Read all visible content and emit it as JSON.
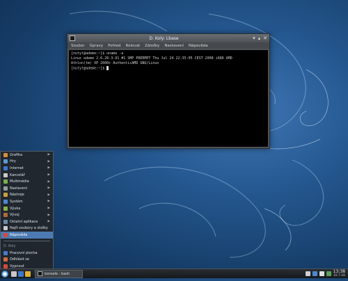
{
  "window": {
    "title": "D. Koly: Lbase",
    "menu": [
      "Soubor",
      "Úpravy",
      "Pohled",
      "Rolovat",
      "Záložky",
      "Nastavení",
      "Nápověda"
    ],
    "terminal_lines": [
      "[nutyt@ademe:~]$ uname -a",
      "Linux ademe 2.6.28-3-91 #1 SMP PREEMPT Thu Jul 24 22:35:05 CEST 2008 i686 AMD",
      "Athlon(tm) XP 2600+ AuthenticAMD GNU/Linux",
      "[nutyt@ademe:~]$ "
    ]
  },
  "start_menu": {
    "items": [
      {
        "label": "Grafika",
        "icon": "graphics-icon",
        "color": "#d4903a",
        "submenu": true
      },
      {
        "label": "Hry",
        "icon": "games-icon",
        "color": "#5a9ad4",
        "submenu": true
      },
      {
        "label": "Internet",
        "icon": "internet-icon",
        "color": "#3a78c8",
        "submenu": true
      },
      {
        "label": "Kancelář",
        "icon": "office-icon",
        "color": "#c8c8c8",
        "submenu": true
      },
      {
        "label": "Multimédia",
        "icon": "multimedia-icon",
        "color": "#7db04a",
        "submenu": true
      },
      {
        "label": "Nastavení",
        "icon": "settings-icon",
        "color": "#9a9a9a",
        "submenu": true
      },
      {
        "label": "Nástroje",
        "icon": "tools-icon",
        "color": "#c8a040",
        "submenu": true
      },
      {
        "label": "Systém",
        "icon": "system-icon",
        "color": "#4a8ad4",
        "submenu": true
      },
      {
        "label": "Výuka",
        "icon": "education-icon",
        "color": "#8ab04a",
        "submenu": true
      },
      {
        "label": "Vývoj",
        "icon": "development-icon",
        "color": "#b06a3a",
        "submenu": true
      },
      {
        "label": "Ostatní aplikace",
        "icon": "other-apps-icon",
        "color": "#6a8aaa",
        "submenu": true
      },
      {
        "label": "Najít soubory a složky",
        "icon": "find-files-icon",
        "color": "#c8c8c8",
        "submenu": false
      },
      {
        "label": "Nápověda",
        "icon": "help-icon",
        "color": "#d44a3a",
        "submenu": false,
        "selected": true
      }
    ],
    "section_header": "D. Koly",
    "bottom_items": [
      {
        "label": "Pracovní plocha",
        "icon": "desktop-icon",
        "color": "#4a7ac8"
      },
      {
        "label": "Odhlásit se",
        "icon": "logout-icon",
        "color": "#d46a3a"
      },
      {
        "label": "Vypnout",
        "icon": "shutdown-icon",
        "color": "#d44a3a"
      }
    ]
  },
  "taskbar": {
    "task_label": "konsole - bash",
    "clock_time": "13:38",
    "clock_date": "30.7.08",
    "quick_launch_colors": [
      "#c8c8c8",
      "#3a78c8",
      "#e0b030"
    ],
    "tray_colors": [
      "#d0d0d0",
      "#4a8ad4",
      "#e0e0e0",
      "#5aa05a"
    ]
  }
}
